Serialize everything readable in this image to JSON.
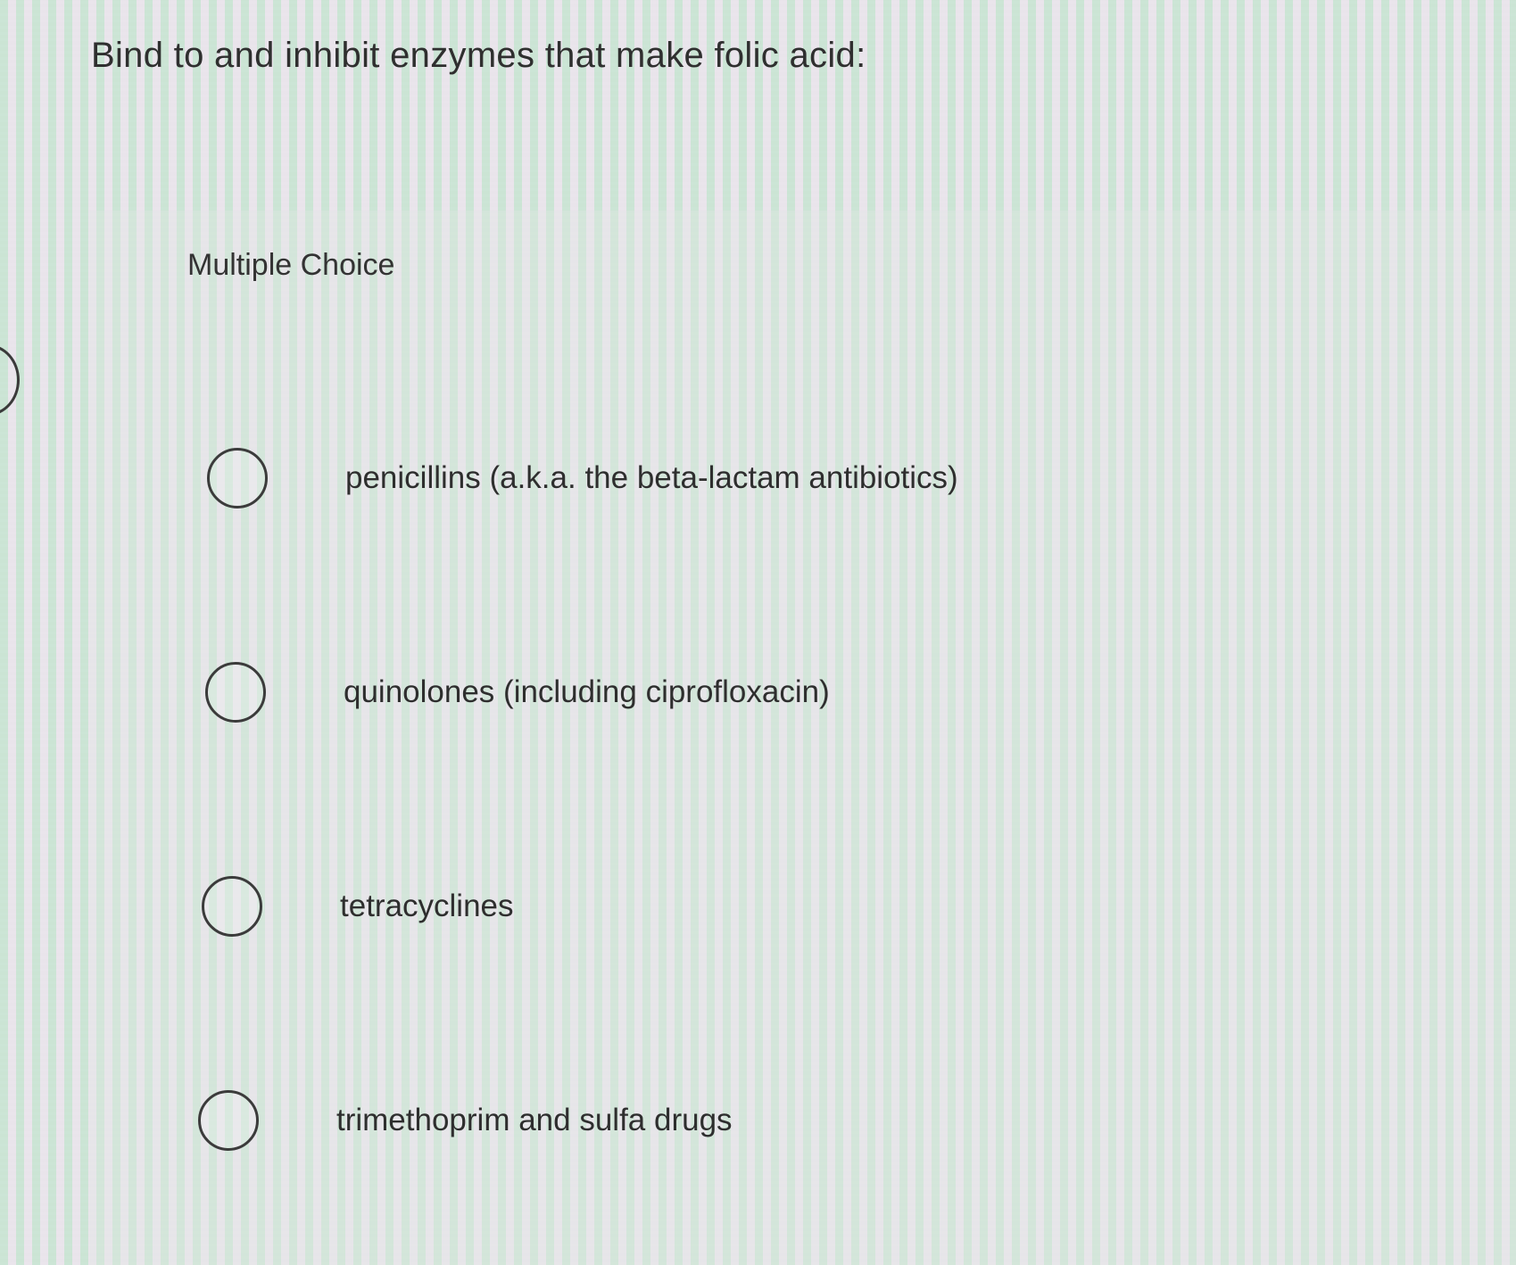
{
  "question": {
    "text": "Bind to and inhibit enzymes that make folic acid:"
  },
  "answer_panel": {
    "type_label": "Multiple Choice",
    "options": [
      {
        "label": "penicillins (a.k.a. the beta-lactam antibiotics)",
        "selected": false
      },
      {
        "label": "quinolones (including ciprofloxacin)",
        "selected": false
      },
      {
        "label": "tetracyclines",
        "selected": false
      },
      {
        "label": "trimethoprim and sulfa drugs",
        "selected": false
      }
    ]
  },
  "colors": {
    "stripe_green": "#c4e2d0",
    "stripe_pink": "#ece2ee",
    "text": "#2e2e2e",
    "radio_border": "#3b3b3b"
  }
}
